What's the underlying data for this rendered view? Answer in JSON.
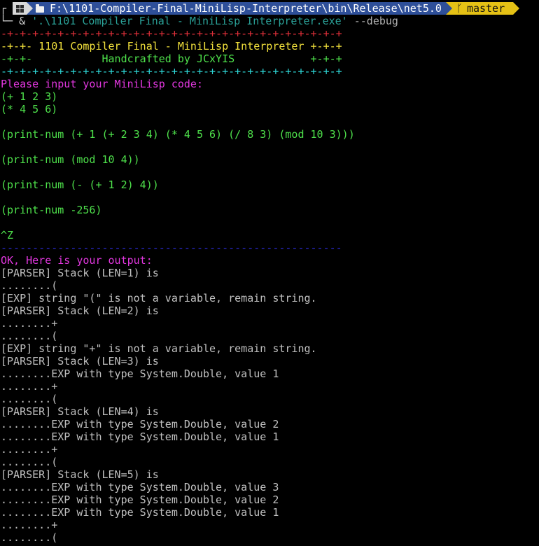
{
  "prompt": {
    "corner": "┌",
    "os_icon": "windows-icon",
    "path": "F:\\1101-Compiler-Final-MiniLisp-Interpreter\\bin\\Release\\net5.0",
    "branch_icon_glyph": "ᚴ",
    "branch": "master",
    "colors": {
      "os_segment": "#d8d8d8",
      "path_segment": "#2e4f99",
      "git_segment": "#e5c115"
    }
  },
  "command": {
    "corner": "└─",
    "amp": "&",
    "exe": "'.\\1101 Compiler Final - MiniLisp Interpreter.exe'",
    "flag": "--debug"
  },
  "output_lines": [
    {
      "text": "-+-+-+-+-+-+-+-+-+-+-+-+-+-+-+-+-+-+-+-+-+-+-+-+-+-+-+",
      "color": "c-red"
    },
    {
      "text": "-+-+- 1101 Compiler Final - MiniLisp Interpreter +-+-+",
      "color": "c-yellow"
    },
    {
      "text": "-+-+-           Handcrafted by JCxYIS            +-+-+",
      "color": "c-green"
    },
    {
      "text": "-+-+-+-+-+-+-+-+-+-+-+-+-+-+-+-+-+-+-+-+-+-+-+-+-+-+-+",
      "color": "c-cyan"
    },
    {
      "text": "Please input your MiniLisp code:",
      "color": "c-magenta"
    },
    {
      "text": "(+ 1 2 3)",
      "color": "c-green"
    },
    {
      "text": "(* 4 5 6)",
      "color": "c-green"
    },
    {
      "text": "",
      "color": "c-green"
    },
    {
      "text": "(print-num (+ 1 (+ 2 3 4) (* 4 5 6) (/ 8 3) (mod 10 3)))",
      "color": "c-green"
    },
    {
      "text": "",
      "color": "c-green"
    },
    {
      "text": "(print-num (mod 10 4))",
      "color": "c-green"
    },
    {
      "text": "",
      "color": "c-green"
    },
    {
      "text": "(print-num (- (+ 1 2) 4))",
      "color": "c-green"
    },
    {
      "text": "",
      "color": "c-green"
    },
    {
      "text": "(print-num -256)",
      "color": "c-green"
    },
    {
      "text": "",
      "color": "c-green"
    },
    {
      "text": "^Z",
      "color": "c-green"
    },
    {
      "text": "------------------------------------------------------",
      "color": "c-blue"
    },
    {
      "text": "OK, Here is your output:",
      "color": "c-magenta"
    },
    {
      "text": "[PARSER] Stack (LEN=1) is",
      "color": "c-gray"
    },
    {
      "text": "........(",
      "color": "c-gray"
    },
    {
      "text": "[EXP] string \"(\" is not a variable, remain string.",
      "color": "c-gray"
    },
    {
      "text": "[PARSER] Stack (LEN=2) is",
      "color": "c-gray"
    },
    {
      "text": "........+",
      "color": "c-gray"
    },
    {
      "text": "........(",
      "color": "c-gray"
    },
    {
      "text": "[EXP] string \"+\" is not a variable, remain string.",
      "color": "c-gray"
    },
    {
      "text": "[PARSER] Stack (LEN=3) is",
      "color": "c-gray"
    },
    {
      "text": "........EXP with type System.Double, value 1",
      "color": "c-gray"
    },
    {
      "text": "........+",
      "color": "c-gray"
    },
    {
      "text": "........(",
      "color": "c-gray"
    },
    {
      "text": "[PARSER] Stack (LEN=4) is",
      "color": "c-gray"
    },
    {
      "text": "........EXP with type System.Double, value 2",
      "color": "c-gray"
    },
    {
      "text": "........EXP with type System.Double, value 1",
      "color": "c-gray"
    },
    {
      "text": "........+",
      "color": "c-gray"
    },
    {
      "text": "........(",
      "color": "c-gray"
    },
    {
      "text": "[PARSER] Stack (LEN=5) is",
      "color": "c-gray"
    },
    {
      "text": "........EXP with type System.Double, value 3",
      "color": "c-gray"
    },
    {
      "text": "........EXP with type System.Double, value 2",
      "color": "c-gray"
    },
    {
      "text": "........EXP with type System.Double, value 1",
      "color": "c-gray"
    },
    {
      "text": "........+",
      "color": "c-gray"
    },
    {
      "text": "........(",
      "color": "c-gray"
    }
  ]
}
